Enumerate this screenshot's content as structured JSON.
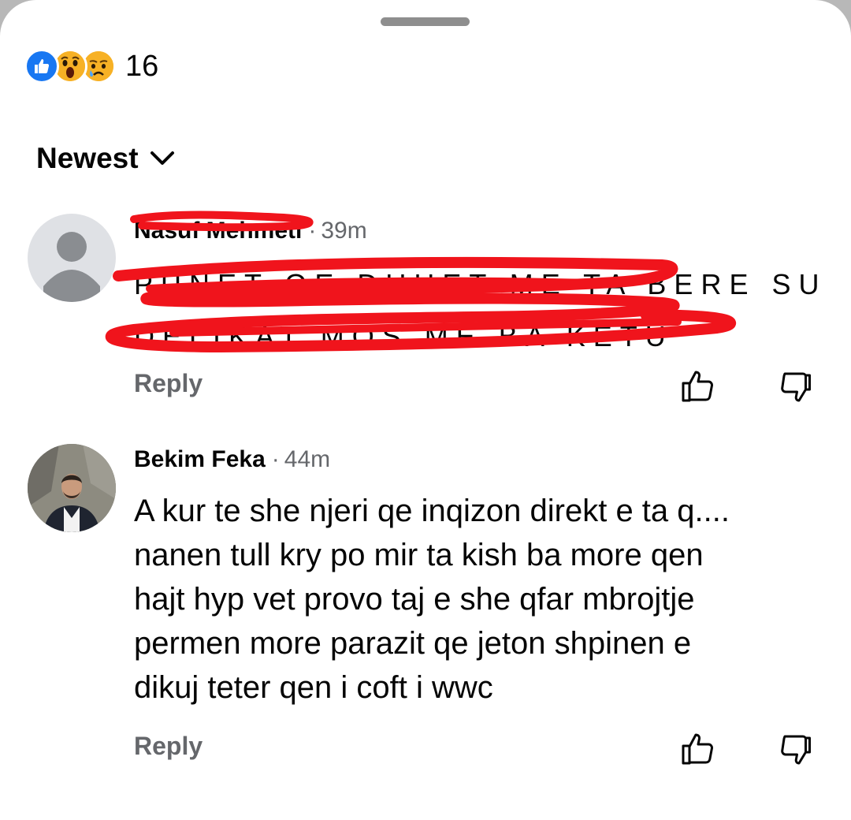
{
  "reactions": {
    "icons": [
      "like-icon",
      "wow-icon",
      "sad-icon"
    ],
    "count": "16"
  },
  "sort": {
    "label": "Newest"
  },
  "comments": [
    {
      "author": "Nasuf Mehmeti",
      "time": "39m",
      "text": "PUNET QE DUHET ME TA BERE SU\nDELIKAT MOS ME BA KETU",
      "redacted": true,
      "reply_label": "Reply"
    },
    {
      "author": "Bekim Feka",
      "time": "44m",
      "text": "A kur te she njeri qe inqizon direkt e ta q....\nnanen tull kry po mir ta kish ba more qen\nhajt hyp vet provo taj e she qfar mbrojtje\npermen more parazit qe jeton shpinen e\ndikuj teter  qen i coft i wwc",
      "redacted": false,
      "reply_label": "Reply"
    }
  ],
  "colors": {
    "text": "#050505",
    "secondary": "#65676b",
    "like_blue": "#1877f2",
    "reaction_yellow": "#f7b125",
    "scribble_red": "#f0141c"
  },
  "middle_dot": "·"
}
